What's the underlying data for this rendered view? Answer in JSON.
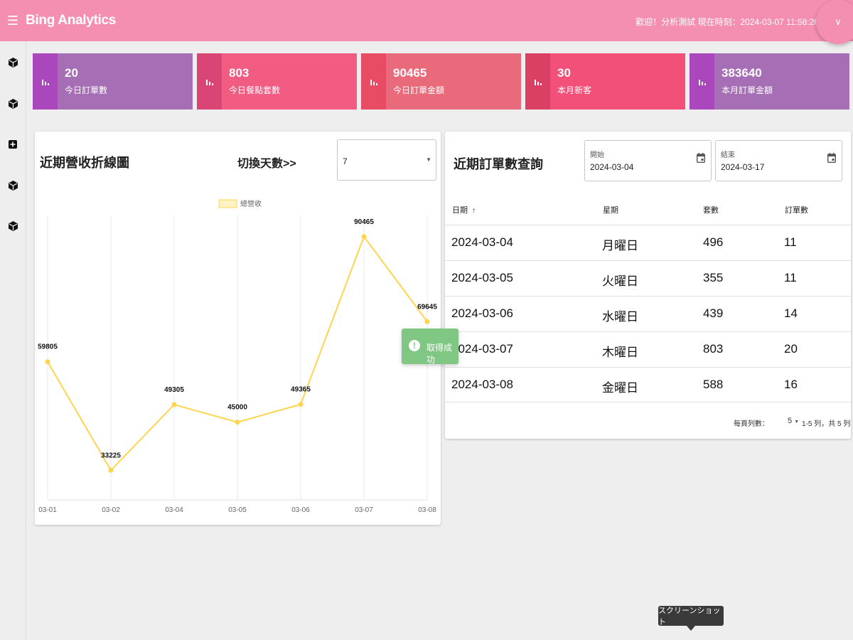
{
  "header": {
    "title": "Bing Analytics",
    "welcome": "歡迎！分析測試 現在時刻：2024-03-07 11:58:20",
    "menu_icon": "hamburger-icon",
    "dropdown_icon": "chevron-down-icon"
  },
  "sidebar": {
    "icons": [
      "cube-icon",
      "cube-icon",
      "plus-box-icon",
      "cube-icon",
      "cube-icon"
    ]
  },
  "stats": [
    {
      "value": "20",
      "label": "今日訂單數",
      "color": "#ab47bc",
      "icon": "bar-chart-icon"
    },
    {
      "value": "803",
      "label": "今日餐點套數",
      "color": "#ec407a",
      "icon": "bar-chart-icon"
    },
    {
      "value": "90465",
      "label": "今日訂單金額",
      "color": "#ef5350",
      "icon": "bar-chart-icon"
    },
    {
      "value": "30",
      "label": "本月新客",
      "color": "#f44336",
      "icon": "bar-chart-icon"
    },
    {
      "value": "383640",
      "label": "本月訂單金額",
      "color": "#ab47bc",
      "icon": "bar-chart-icon"
    }
  ],
  "revenue_panel": {
    "title": "近期營收折線圖",
    "switch_label": "切換天數>>",
    "days_selected": "7"
  },
  "chart_data": {
    "type": "line",
    "x": [
      "03-01",
      "03-02",
      "03-04",
      "03-05",
      "03-06",
      "03-07",
      "03-08"
    ],
    "series": [
      {
        "name": "總營收",
        "values": [
          59805,
          33225,
          49305,
          45000,
          49365,
          90465,
          69645
        ]
      }
    ],
    "ylim": [
      27000,
      96000
    ],
    "grid_vertical": true,
    "legend": "top-center",
    "color": "#ffd54f"
  },
  "orders_panel": {
    "title": "近期訂單數查詢",
    "start_label": "開始",
    "start_value": "2024-03-04",
    "end_label": "結束",
    "end_value": "2024-03-17",
    "columns": [
      "日期",
      "星期",
      "套數",
      "訂單數"
    ],
    "sort_icon": "arrow-up-icon",
    "rows": [
      [
        "2024-03-04",
        "月曜日",
        "496",
        "11"
      ],
      [
        "2024-03-05",
        "火曜日",
        "355",
        "11"
      ],
      [
        "2024-03-06",
        "水曜日",
        "439",
        "14"
      ],
      [
        "2024-03-07",
        "木曜日",
        "803",
        "20"
      ],
      [
        "2024-03-08",
        "金曜日",
        "588",
        "16"
      ]
    ],
    "rows_per_page_label": "每頁列數：",
    "rows_per_page": "5",
    "range_text": "1-5 列，共 5 列"
  },
  "toast": {
    "text": "取得成功",
    "icon": "alert-icon"
  },
  "tooltip": {
    "text": "スクリーンショット"
  }
}
